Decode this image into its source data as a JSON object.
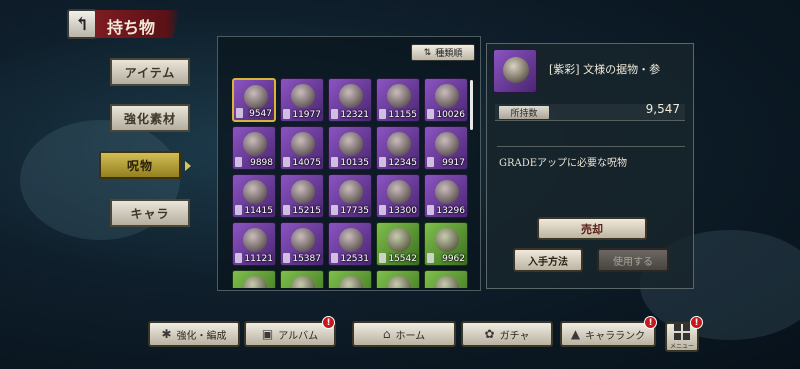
{
  "header": {
    "title": "持ち物"
  },
  "tabs": [
    {
      "label": "アイテム",
      "active": false
    },
    {
      "label": "強化素材",
      "active": false
    },
    {
      "label": "呪物",
      "active": true
    },
    {
      "label": "キャラ",
      "active": false
    }
  ],
  "sort": {
    "label": "種類順",
    "icon": "sort-icon"
  },
  "items": [
    {
      "count": "9547",
      "rarity": "purple",
      "selected": true
    },
    {
      "count": "11977",
      "rarity": "purple"
    },
    {
      "count": "12321",
      "rarity": "purple"
    },
    {
      "count": "11155",
      "rarity": "purple"
    },
    {
      "count": "10026",
      "rarity": "purple"
    },
    {
      "count": "9898",
      "rarity": "purple"
    },
    {
      "count": "14075",
      "rarity": "purple"
    },
    {
      "count": "10135",
      "rarity": "purple"
    },
    {
      "count": "12345",
      "rarity": "purple"
    },
    {
      "count": "9917",
      "rarity": "purple"
    },
    {
      "count": "11415",
      "rarity": "purple"
    },
    {
      "count": "15215",
      "rarity": "purple"
    },
    {
      "count": "17735",
      "rarity": "purple"
    },
    {
      "count": "13300",
      "rarity": "purple"
    },
    {
      "count": "13296",
      "rarity": "purple"
    },
    {
      "count": "11121",
      "rarity": "purple"
    },
    {
      "count": "15387",
      "rarity": "purple"
    },
    {
      "count": "12531",
      "rarity": "purple"
    },
    {
      "count": "15542",
      "rarity": "green"
    },
    {
      "count": "9962",
      "rarity": "green"
    },
    {
      "count": "",
      "rarity": "green"
    },
    {
      "count": "",
      "rarity": "green"
    },
    {
      "count": "",
      "rarity": "green"
    },
    {
      "count": "",
      "rarity": "green"
    },
    {
      "count": "",
      "rarity": "green"
    }
  ],
  "detail": {
    "name": "[紫彩] 文様の据物・参",
    "owned_label": "所持数",
    "owned_value": "9,547",
    "grade_text": "GRADEアップに必要な呪物",
    "sell_label": "売却",
    "obtain_label": "入手方法",
    "use_label": "使用する"
  },
  "bottom_nav": [
    {
      "label": "強化・編成",
      "icon": "enhance-icon",
      "badge": false
    },
    {
      "label": "アルバム",
      "icon": "album-icon",
      "badge": true
    },
    {
      "label": "ホーム",
      "icon": "home-icon",
      "badge": false
    },
    {
      "label": "ガチャ",
      "icon": "gacha-icon",
      "badge": false
    },
    {
      "label": "キャラランク",
      "icon": "rank-icon",
      "badge": true
    }
  ],
  "menu": {
    "label": "メニュー",
    "badge": true
  },
  "badge_text": "!",
  "colors": {
    "accent_red": "#7e1c22",
    "active_tab": "#d3bd55",
    "rarity_purple": "#8b54c2",
    "rarity_green": "#7fc04c"
  }
}
